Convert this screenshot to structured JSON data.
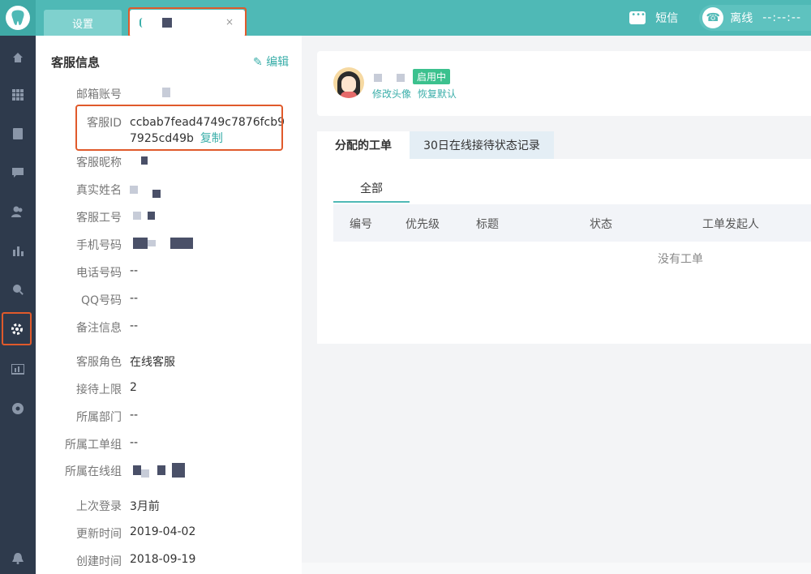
{
  "topbar": {
    "tabs": [
      {
        "label": "设置"
      },
      {
        "label": "",
        "close": "×"
      }
    ],
    "sms_label": "短信",
    "status_label": "离线",
    "status_time": "--:--:--"
  },
  "nav": {
    "items": [
      "home-icon",
      "grid-icon",
      "document-icon",
      "chat-icon",
      "users-icon",
      "stats-icon",
      "search-stats-icon",
      "gear-icon",
      "report-icon",
      "target-icon",
      "bell-icon"
    ],
    "active": "gear-icon"
  },
  "info": {
    "title": "客服信息",
    "edit_label": "编辑",
    "fields": [
      {
        "label": "邮箱账号",
        "value": ""
      },
      {
        "label": "客服ID",
        "value_line1": "ccbab7fead4749c7876fcb9",
        "value_line2": "7925cd49b",
        "copy": "复制"
      },
      {
        "label": "客服昵称",
        "value": ""
      },
      {
        "label": "真实姓名",
        "value": ""
      },
      {
        "label": "客服工号",
        "value": ""
      },
      {
        "label": "手机号码",
        "value": ""
      },
      {
        "label": "电话号码",
        "value": "--"
      },
      {
        "label": "QQ号码",
        "value": "--"
      },
      {
        "label": "备注信息",
        "value": "--"
      },
      {
        "label": "客服角色",
        "value": "在线客服"
      },
      {
        "label": "接待上限",
        "value": "2"
      },
      {
        "label": "所属部门",
        "value": "--"
      },
      {
        "label": "所属工单组",
        "value": "--"
      },
      {
        "label": "所属在线组",
        "value": ""
      },
      {
        "label": "上次登录",
        "value": "3月前"
      },
      {
        "label": "更新时间",
        "value": "2019-04-02"
      },
      {
        "label": "创建时间",
        "value": "2018-09-19"
      }
    ]
  },
  "profile": {
    "badge": "启用中",
    "change_avatar": "修改头像",
    "restore_default": "恢复默认"
  },
  "main_tabs": [
    "分配的工单",
    "30日在线接待状态记录"
  ],
  "tickets": {
    "subtab": "全部",
    "columns": [
      "编号",
      "优先级",
      "标题",
      "状态",
      "工单发起人"
    ],
    "empty_text": "没有工单"
  },
  "colors": {
    "teal": "#4fb9b6",
    "nav_bg": "#2e3a4c",
    "highlight": "#e05a2b",
    "badge_green": "#3cc18e"
  }
}
